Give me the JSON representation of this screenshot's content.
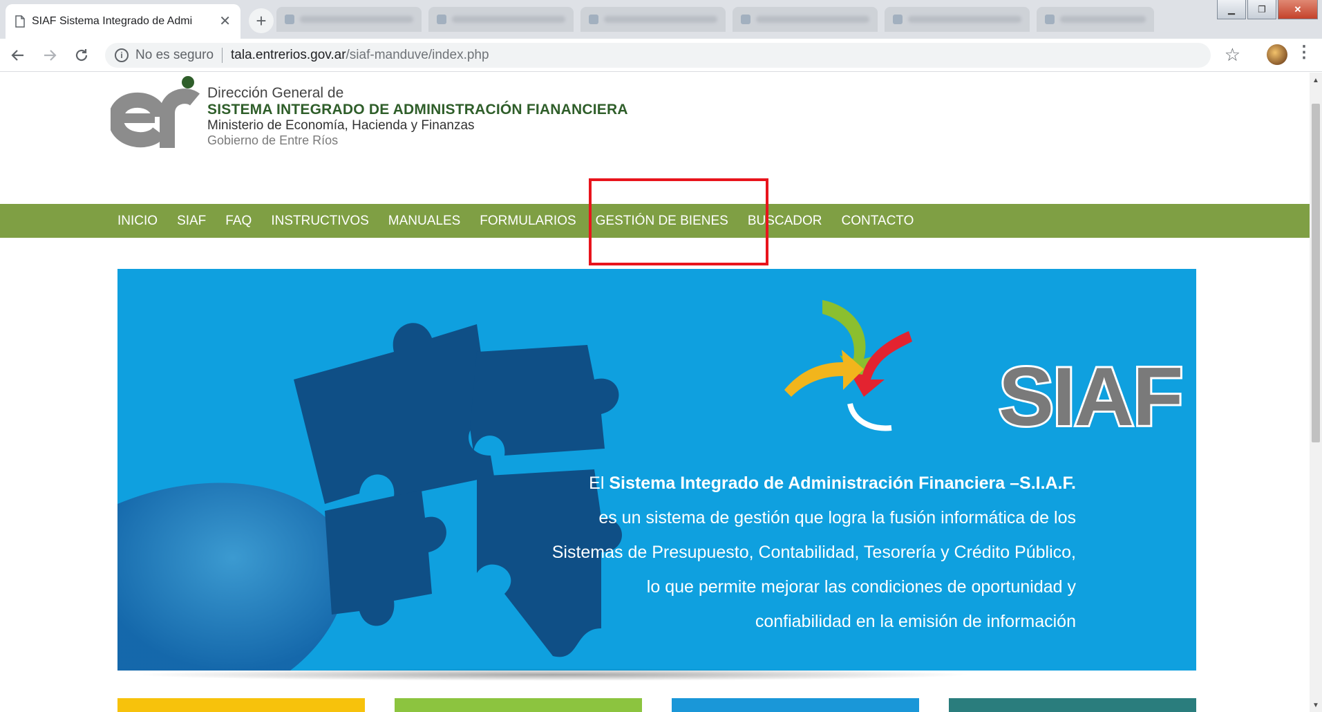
{
  "browser": {
    "tab_title": "SIAF Sistema Integrado de Admi",
    "security_label": "No es seguro",
    "url_host": "tala.entrerios.gov.ar",
    "url_path": "/siaf-manduve/index.php"
  },
  "header": {
    "line1": "Dirección General de",
    "line2": "SISTEMA INTEGRADO DE ADMINISTRACIÓN FIANANCIERA",
    "line3": "Ministerio de Economía, Hacienda y Finanzas",
    "line4": "Gobierno de Entre Ríos"
  },
  "nav": {
    "items": [
      {
        "label": "INICIO"
      },
      {
        "label": "SIAF"
      },
      {
        "label": "FAQ"
      },
      {
        "label": "INSTRUCTIVOS"
      },
      {
        "label": "MANUALES"
      },
      {
        "label": "FORMULARIOS"
      },
      {
        "label": "GESTIÓN DE BIENES"
      },
      {
        "label": "BUSCADOR"
      },
      {
        "label": "CONTACTO"
      }
    ]
  },
  "hero": {
    "logo_word": "SIAF",
    "text_prefix": "El ",
    "text_bold": "Sistema Integrado de Administración Financiera –S.I.A.F.",
    "line2": "es un sistema de gestión que logra la fusión informática de los",
    "line3": "Sistemas de Presupuesto, Contabilidad, Tesorería y Crédito Público,",
    "line4": "lo que permite mejorar las condiciones de oportunidad y",
    "line5": "confiabilidad en la emisión de información"
  },
  "colors": {
    "nav_bg": "#7f9f44",
    "hero_bg": "#0fa0df",
    "highlight": "#e8141c",
    "tile_yellow": "#f7c20c",
    "tile_green": "#8cc43f",
    "tile_blue": "#1a97d8",
    "tile_teal": "#2a7d7d"
  }
}
